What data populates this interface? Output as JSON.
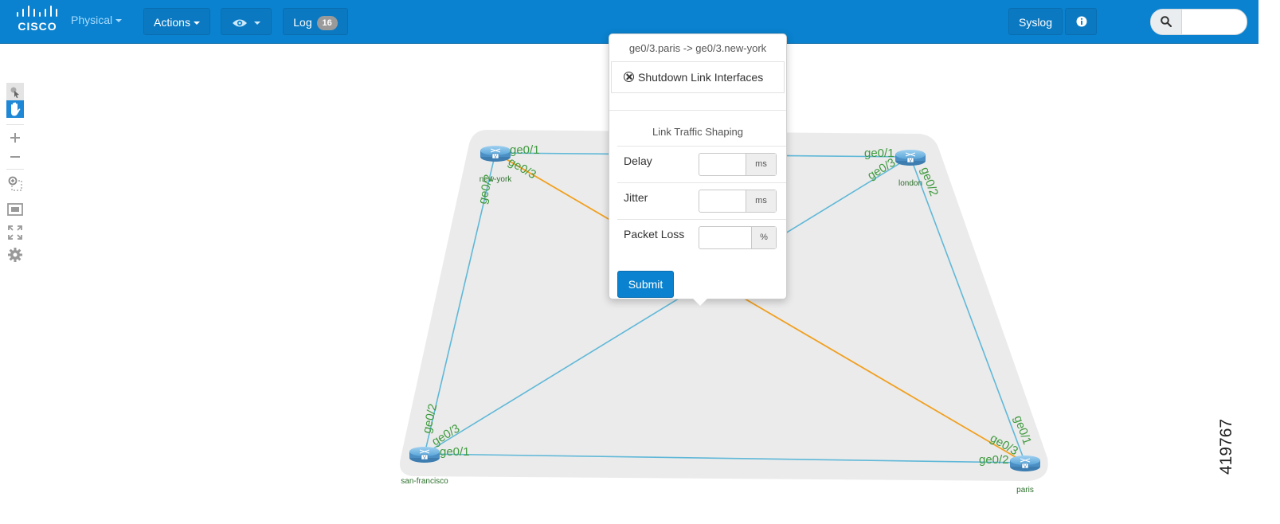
{
  "header": {
    "logo_text": "CISCO",
    "logo_icon": "cisco-bars-logo",
    "view_menu_label": "Physical",
    "actions_label": "Actions",
    "eye_menu_icon": "eye-icon",
    "log_label": "Log",
    "log_count": "16",
    "syslog_label": "Syslog",
    "info_icon": "info-icon",
    "search_icon": "search-icon",
    "search_value": "",
    "brand_color": "#0a82cf"
  },
  "toolbar": {
    "tools": [
      "select-icon",
      "pan-hand-icon",
      "zoom-in-icon",
      "zoom-out-icon",
      "zoom-selection-icon",
      "fit-view-icon",
      "fullscreen-icon",
      "settings-gear-icon"
    ],
    "active_tool": "pan-hand-icon"
  },
  "topology": {
    "nodes": [
      {
        "name": "new-york"
      },
      {
        "name": "london"
      },
      {
        "name": "san-francisco"
      },
      {
        "name": "paris"
      }
    ],
    "ports": {
      "ny_1": "ge0/1",
      "ny_3": "ge0/3",
      "ny_2": "ge0/2",
      "ld_1": "ge0/1",
      "ld_3": "ge0/3",
      "ld_2": "ge0/2",
      "sf_2": "ge0/2",
      "sf_3": "ge0/3",
      "sf_1": "ge0/1",
      "pa_1": "ge0/1",
      "pa_3": "ge0/3",
      "pa_2": "ge0/2"
    },
    "link_color": "#5fb8d8",
    "selected_link_color": "#f0a020"
  },
  "popover": {
    "title": "ge0/3.paris -> ge0/3.new-york",
    "shutdown_label": "Shutdown Link Interfaces",
    "shaping_title": "Link Traffic Shaping",
    "fields": [
      {
        "label": "Delay",
        "value": "",
        "unit": "ms"
      },
      {
        "label": "Jitter",
        "value": "",
        "unit": "ms"
      },
      {
        "label": "Packet Loss",
        "value": "",
        "unit": "%"
      }
    ],
    "submit_label": "Submit"
  },
  "figure_number": "419767"
}
